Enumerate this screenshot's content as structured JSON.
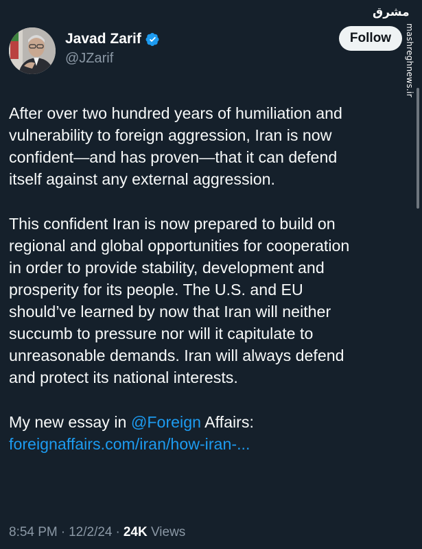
{
  "author": {
    "name": "Javad Zarif",
    "handle": "@JZarif",
    "verified": true
  },
  "follow_label": "Follow",
  "watermark": {
    "logo_text": "مشرق",
    "site": "mashreghnews.ir"
  },
  "tweet": {
    "paragraph1": "After over two hundred years of humiliation and\nvulnerability to foreign aggression, Iran is now\nconfident—and has proven—that it can defend\nitself against any external aggression.",
    "paragraph2": "This confident Iran is now prepared to build on\nregional and global opportunities for cooperation\nin order to provide stability, development and\nprosperity for its people. The U.S. and EU\nshould’ve learned by now that Iran will neither\nsuccumb to pressure nor will it capitulate to\nunreasonable demands. Iran will always defend\nand protect its national interests.",
    "essay_prefix": "My new essay in ",
    "mention": "@Foreign",
    "essay_suffix": " Affairs:",
    "link": "foreignaffairs.com/iran/how-iran-..."
  },
  "meta": {
    "time": "8:54 PM",
    "separator": "·",
    "date": "12/2/24",
    "views_count": "24K",
    "views_label": "Views"
  },
  "colors": {
    "background": "#15202b",
    "link": "#1d9bf0",
    "verified": "#1d9bf0",
    "secondary_text": "#8b98a5"
  },
  "icons": [
    "verified-badge-icon"
  ]
}
